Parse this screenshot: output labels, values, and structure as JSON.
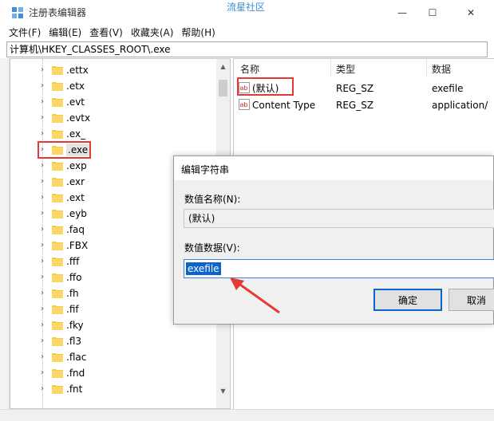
{
  "window": {
    "title": "注册表编辑器",
    "watermark": "流星社区",
    "minimize": "—",
    "maximize": "☐",
    "close": "✕"
  },
  "menu": [
    "文件(F)",
    "编辑(E)",
    "查看(V)",
    "收藏夹(A)",
    "帮助(H)"
  ],
  "address": "计算机\\HKEY_CLASSES_ROOT\\.exe",
  "tree": {
    "items": [
      ".ettx",
      ".etx",
      ".evt",
      ".evtx",
      ".ex_",
      ".exe",
      ".exp",
      ".exr",
      ".ext",
      ".eyb",
      ".faq",
      ".FBX",
      ".fff",
      ".ffo",
      ".fh",
      ".fif",
      ".fky",
      ".fl3",
      ".flac",
      ".fnd",
      ".fnt"
    ],
    "selected": ".exe"
  },
  "list": {
    "columns": [
      "名称",
      "类型",
      "数据"
    ],
    "rows": [
      {
        "name": "(默认)",
        "type": "REG_SZ",
        "data": "exefile"
      },
      {
        "name": "Content Type",
        "type": "REG_SZ",
        "data": "application/"
      }
    ]
  },
  "dialog": {
    "title": "编辑字符串",
    "name_label": "数值名称(N):",
    "name_value": "(默认)",
    "data_label": "数值数据(V):",
    "data_value": "exefile",
    "ok": "确定",
    "cancel": "取消"
  },
  "colors": {
    "highlight": "#e53935",
    "selection": "#0a64cc",
    "folder": "#f7c948"
  }
}
